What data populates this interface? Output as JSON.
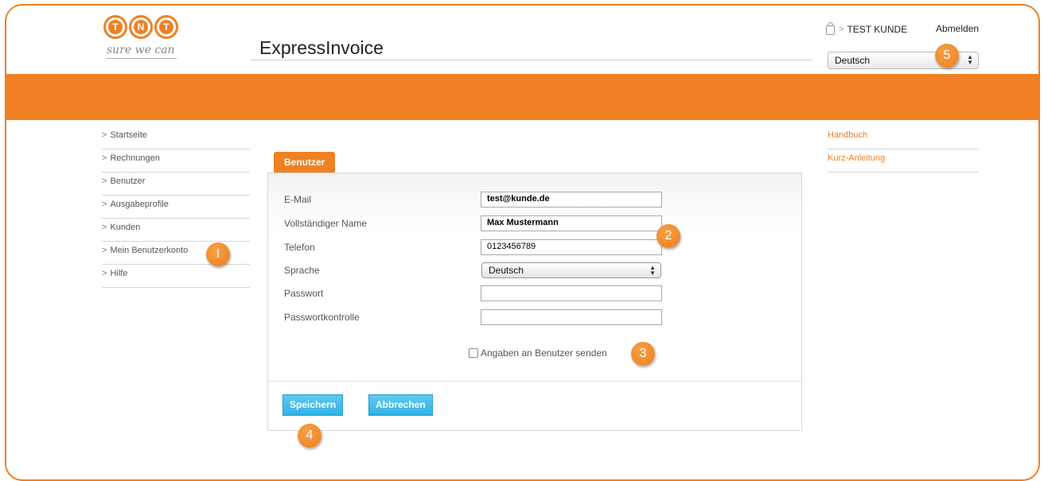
{
  "brand": {
    "logo_text": "TNT",
    "tagline": "sure we can"
  },
  "header": {
    "app_title": "ExpressInvoice",
    "user_name": "TEST KUNDE",
    "logout_label": "Abmelden",
    "language_select": "Deutsch"
  },
  "nav": {
    "items": [
      {
        "label": "Startseite"
      },
      {
        "label": "Rechnungen"
      },
      {
        "label": "Benutzer"
      },
      {
        "label": "Ausgabeprofile"
      },
      {
        "label": "Kunden"
      },
      {
        "label": "Mein Benutzerkonto"
      },
      {
        "label": "Hilfe"
      }
    ]
  },
  "right_links": [
    {
      "label": "Handbuch"
    },
    {
      "label": "Kurz-Anleitung"
    }
  ],
  "form": {
    "tab_label": "Benutzer",
    "fields": {
      "email": {
        "label": "E-Mail",
        "value": "test@kunde.de"
      },
      "name": {
        "label": "Vollständiger Name",
        "value": "Max Mustermann"
      },
      "phone": {
        "label": "Telefon",
        "value": "0123456789"
      },
      "language": {
        "label": "Sprache",
        "value": "Deutsch"
      },
      "password": {
        "label": "Passwort",
        "value": ""
      },
      "password_confirm": {
        "label": "Passwortkontrolle",
        "value": ""
      }
    },
    "send_checkbox_label": "Angaben an Benutzer senden",
    "save_label": "Speichern",
    "cancel_label": "Abbrechen"
  },
  "badges": [
    "I",
    "2",
    "3",
    "4",
    "5"
  ],
  "colors": {
    "accent": "#f08022",
    "button": "#2fb3e6"
  }
}
